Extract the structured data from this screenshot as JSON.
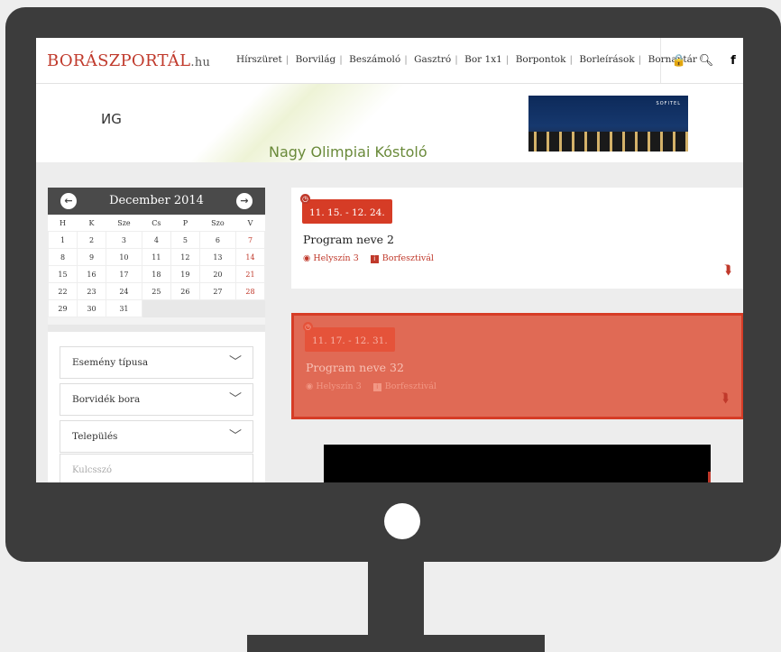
{
  "logo": {
    "part1": "BORÁSZ",
    "part2": "PORTÁL",
    "suffix": ".hu"
  },
  "nav": [
    "Hírszüret",
    "Borvilág",
    "Beszámoló",
    "Gasztró",
    "Bor 1x1",
    "Borpontok",
    "Borleírások",
    "Bornaptár"
  ],
  "icons": {
    "lock": "lock-icon",
    "search": "search-icon",
    "facebook": "facebook-icon"
  },
  "banner": {
    "text": "ИG",
    "subtext": "Nagy Olimpiai Kóstoló"
  },
  "hotel_sign": "SOFITEL",
  "calendar": {
    "title": "December 2014",
    "weekdays": [
      "H",
      "K",
      "Sze",
      "Cs",
      "P",
      "Szo",
      "V"
    ],
    "weeks": [
      [
        "1",
        "2",
        "3",
        "4",
        "5",
        "6",
        "7"
      ],
      [
        "8",
        "9",
        "10",
        "11",
        "12",
        "13",
        "14"
      ],
      [
        "15",
        "16",
        "17",
        "18",
        "19",
        "20",
        "21"
      ],
      [
        "22",
        "23",
        "24",
        "25",
        "26",
        "27",
        "28"
      ],
      [
        "29",
        "30",
        "31",
        "",
        "",
        "",
        ""
      ]
    ]
  },
  "filters": {
    "event_type": "Esemény típusa",
    "wine_region": "Borvidék bora",
    "settlement": "Település",
    "keyword_placeholder": "Kulcsszó"
  },
  "events": [
    {
      "date": "11. 15. - 12. 24.",
      "title": "Program neve 2",
      "location": "Helyszín 3",
      "category": "Borfesztivál",
      "highlighted": false
    },
    {
      "date": "11. 17. - 12. 31.",
      "title": "Program neve 32",
      "location": "Helyszín 3",
      "category": "Borfesztivál",
      "highlighted": true
    }
  ],
  "colors": {
    "accent": "#c0392b",
    "highlight": "#e06a55",
    "monitor": "#3c3c3c"
  }
}
